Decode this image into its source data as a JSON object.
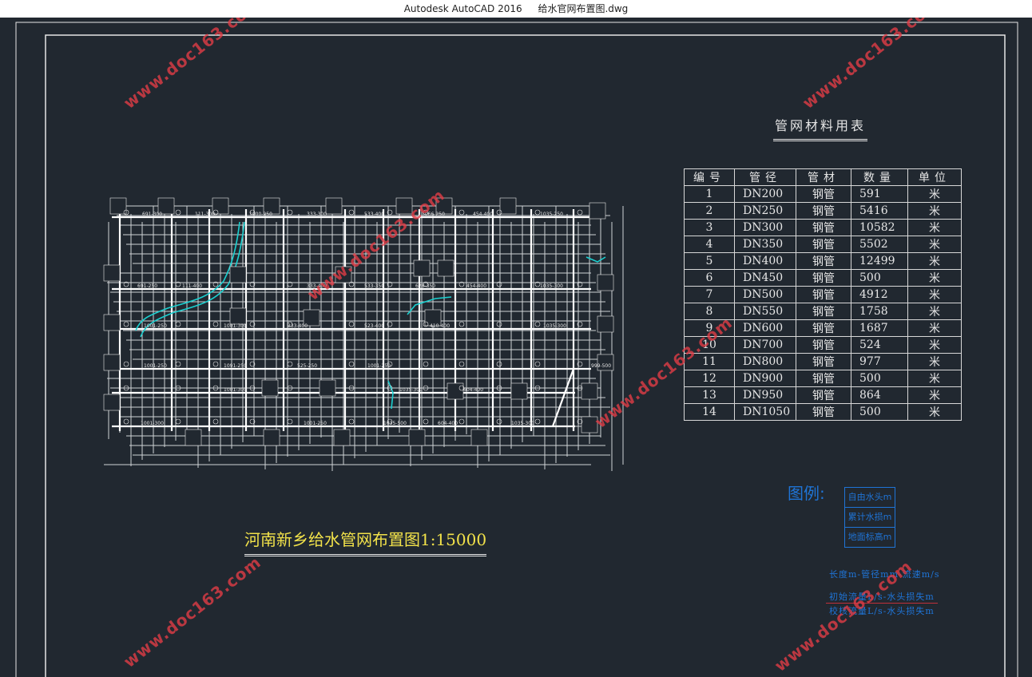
{
  "window": {
    "app": "Autodesk AutoCAD 2016",
    "file": "给水官网布置图.dwg"
  },
  "table": {
    "title": "管网材料用表",
    "headers": [
      "编号",
      "管径",
      "管材",
      "数量",
      "单位"
    ],
    "rows": [
      [
        "1",
        "DN200",
        "钢管",
        "591",
        "米"
      ],
      [
        "2",
        "DN250",
        "钢管",
        "5416",
        "米"
      ],
      [
        "3",
        "DN300",
        "钢管",
        "10582",
        "米"
      ],
      [
        "4",
        "DN350",
        "钢管",
        "5502",
        "米"
      ],
      [
        "5",
        "DN400",
        "钢管",
        "12499",
        "米"
      ],
      [
        "6",
        "DN450",
        "钢管",
        "500",
        "米"
      ],
      [
        "7",
        "DN500",
        "钢管",
        "4912",
        "米"
      ],
      [
        "8",
        "DN550",
        "钢管",
        "1758",
        "米"
      ],
      [
        "9",
        "DN600",
        "钢管",
        "1687",
        "米"
      ],
      [
        "10",
        "DN700",
        "钢管",
        "524",
        "米"
      ],
      [
        "11",
        "DN800",
        "钢管",
        "977",
        "米"
      ],
      [
        "12",
        "DN900",
        "钢管",
        "500",
        "米"
      ],
      [
        "13",
        "DN950",
        "钢管",
        "864",
        "米"
      ],
      [
        "14",
        "DN1050",
        "钢管",
        "500",
        "米"
      ]
    ]
  },
  "map": {
    "title": "河南新乡给水管网布置图1:15000",
    "pipe_labels": [
      "691-300",
      "111-300",
      "1000-250",
      "333-300",
      "533-400",
      "1066-250",
      "454-400",
      "1035-250",
      "691-250",
      "111-400",
      "333-400",
      "533-350",
      "628-350",
      "454-400",
      "1035-300",
      "1001-250",
      "1001-300",
      "333-400",
      "523-400",
      "410-400",
      "1035-300",
      "1001-250",
      "1091-250",
      "525-250",
      "1001-250",
      "999-500",
      "1001-300",
      "1035-300",
      "604-400",
      "1001-300",
      "1001-250",
      "1035-500",
      "1035-300",
      "604-400"
    ]
  },
  "legend": {
    "label": "图例:",
    "items": [
      "自由水头m",
      "累计水损m",
      "地面标高m"
    ],
    "note_line1": "长度m-管径mm-流速m/s",
    "note_line2": "初始流量L/s-水头损失m",
    "note_line3": "校核流量L/s-水头损失m"
  },
  "watermark": "www.doc163.com",
  "colors": {
    "background": "#212830",
    "lines": "#e6e6e6",
    "accent_blue": "#1f74d6",
    "title_yellow": "#f2e24a",
    "watermark_red": "#e13c46",
    "river_cyan": "#1bd0d0"
  }
}
